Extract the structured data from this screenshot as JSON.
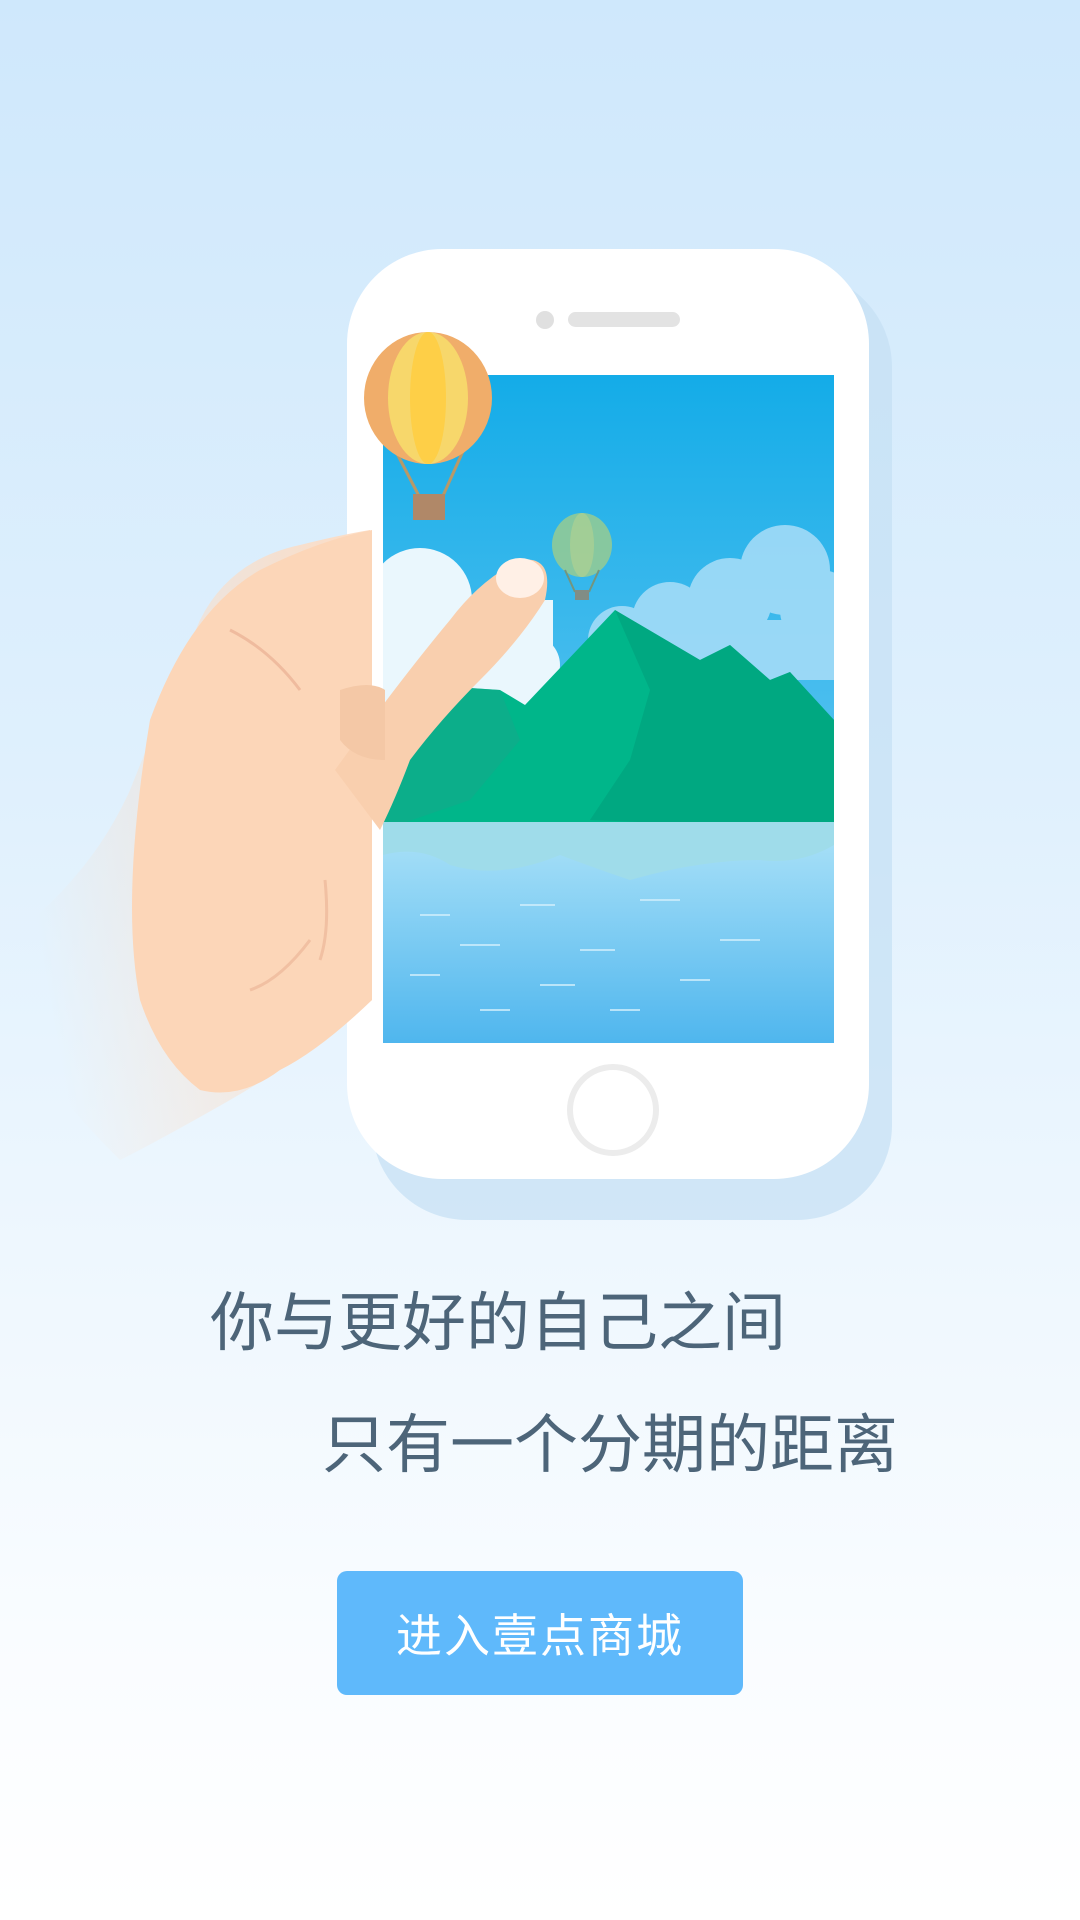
{
  "headline": {
    "line1": "你与更好的自己之间",
    "line2": "只有一个分期的距离"
  },
  "cta": {
    "label": "进入壹点商城"
  },
  "colors": {
    "background_top": "#cfe8fc",
    "background_bottom": "#ffffff",
    "text": "#4d6579",
    "button": "#5fb9fb",
    "button_text": "#ffffff",
    "phone_body": "#ffffff",
    "mountain": "#00b68a",
    "sky": "#1aaee9",
    "water": "#7ccaf5"
  },
  "illustration": {
    "elements": [
      "hand-icon",
      "smartphone-icon",
      "hot-air-balloon-icon",
      "mountain-icon",
      "cloud-icon",
      "water-icon"
    ]
  }
}
